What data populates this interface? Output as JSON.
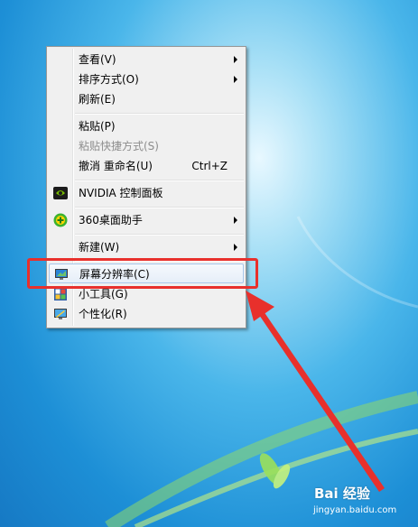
{
  "context_menu": {
    "items": [
      {
        "label": "查看(V)",
        "submenu": true
      },
      {
        "label": "排序方式(O)",
        "submenu": true
      },
      {
        "label": "刷新(E)"
      },
      {
        "label": "粘贴(P)"
      },
      {
        "label": "粘贴快捷方式(S)",
        "disabled": true
      },
      {
        "label": "撤消 重命名(U)",
        "shortcut": "Ctrl+Z"
      },
      {
        "label": "NVIDIA 控制面板",
        "icon": "nvidia-icon"
      },
      {
        "label": "360桌面助手",
        "submenu": true,
        "icon": "360-icon"
      },
      {
        "label": "新建(W)",
        "submenu": true
      },
      {
        "label": "屏幕分辨率(C)",
        "icon": "monitor-icon",
        "highlighted": true
      },
      {
        "label": "小工具(G)",
        "icon": "gadgets-icon"
      },
      {
        "label": "个性化(R)",
        "icon": "personalize-icon"
      }
    ]
  },
  "annotation": {
    "box_color": "#e8302c",
    "arrow_color": "#e8302c"
  },
  "watermark": {
    "brand": "Bai 经验",
    "url": "jingyan.baidu.com"
  }
}
